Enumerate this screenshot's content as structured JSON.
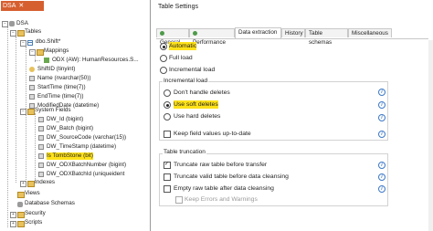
{
  "doc_tab": {
    "label": "DSA",
    "close": "✕"
  },
  "tree": {
    "root": "DSA",
    "tables": "Tables",
    "table": "dbo.Shift*",
    "mappings": "Mappings",
    "mapping_item": "ODX (AW): HumanResources.S...",
    "columns": [
      "ShiftID (tinyint)",
      "Name (nvarchar(50))",
      "StartTime (time(7))",
      "EndTime (time(7))",
      "ModifiedDate (datetime)"
    ],
    "system_fields": "System Fields",
    "system_columns": [
      "DW_Id (bigint)",
      "DW_Batch (bigint)",
      "DW_SourceCode (varchar(15))",
      "DW_TimeStamp (datetime)",
      "Is TombStone (bit)",
      "DW_ODXBatchNumber (bigint)",
      "DW_ODXBatchId (uniqueident"
    ],
    "indexes": "Indexes",
    "views": "Views",
    "database_schemas": "Database Schemas",
    "security": "Security",
    "scripts": "Scripts"
  },
  "dialog": {
    "title": "Table Settings",
    "tabs": [
      "General",
      "Performance",
      "Data extraction",
      "History",
      "Table schemas",
      "Miscellaneous"
    ],
    "active_tab": "Data extraction",
    "load_options": [
      "Automatic",
      "Full load",
      "Incremental load"
    ],
    "incremental_group": "Incremental load",
    "delete_options": [
      "Don't handle deletes",
      "Use soft deletes",
      "Use hard deletes"
    ],
    "keep_field_values": "Keep field values up-to-date",
    "truncation_group": "Table truncation",
    "truncation_options": [
      "Truncate raw table before transfer",
      "Truncate valid table before data cleansing",
      "Empty raw table after data cleansing"
    ],
    "keep_errors": "Keep Errors and Warnings",
    "info_glyph": "i"
  },
  "colors": {
    "highlight": "#ffe21a",
    "tab_accent": "#d65f2f",
    "info": "#3d78c8"
  }
}
